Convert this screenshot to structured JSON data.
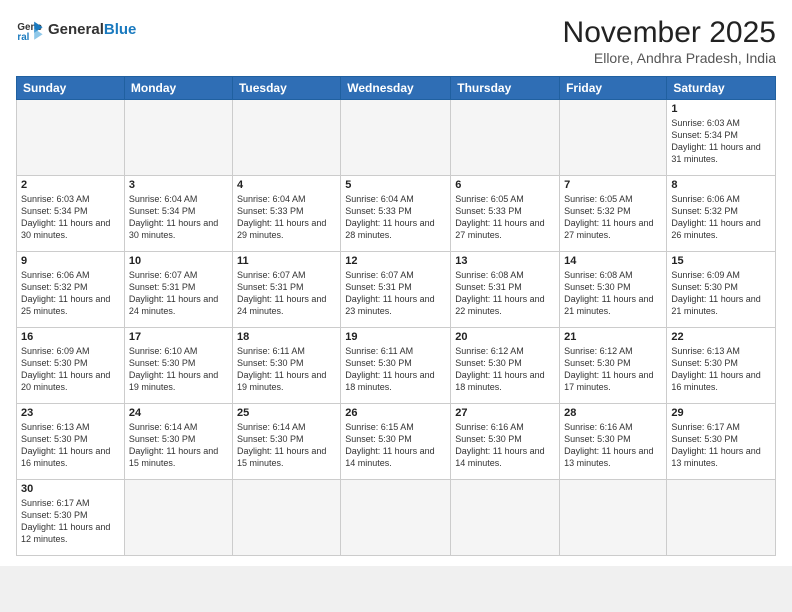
{
  "header": {
    "logo_general": "General",
    "logo_blue": "Blue",
    "month_title": "November 2025",
    "location": "Ellore, Andhra Pradesh, India"
  },
  "weekdays": [
    "Sunday",
    "Monday",
    "Tuesday",
    "Wednesday",
    "Thursday",
    "Friday",
    "Saturday"
  ],
  "weeks": [
    [
      {
        "day": "",
        "empty": true
      },
      {
        "day": "",
        "empty": true
      },
      {
        "day": "",
        "empty": true
      },
      {
        "day": "",
        "empty": true
      },
      {
        "day": "",
        "empty": true
      },
      {
        "day": "",
        "empty": true
      },
      {
        "day": "1",
        "sunrise": "6:03 AM",
        "sunset": "5:34 PM",
        "daylight": "11 hours and 31 minutes."
      }
    ],
    [
      {
        "day": "2",
        "sunrise": "6:03 AM",
        "sunset": "5:34 PM",
        "daylight": "11 hours and 30 minutes."
      },
      {
        "day": "3",
        "sunrise": "6:04 AM",
        "sunset": "5:34 PM",
        "daylight": "11 hours and 30 minutes."
      },
      {
        "day": "4",
        "sunrise": "6:04 AM",
        "sunset": "5:33 PM",
        "daylight": "11 hours and 29 minutes."
      },
      {
        "day": "5",
        "sunrise": "6:04 AM",
        "sunset": "5:33 PM",
        "daylight": "11 hours and 28 minutes."
      },
      {
        "day": "6",
        "sunrise": "6:05 AM",
        "sunset": "5:33 PM",
        "daylight": "11 hours and 27 minutes."
      },
      {
        "day": "7",
        "sunrise": "6:05 AM",
        "sunset": "5:32 PM",
        "daylight": "11 hours and 27 minutes."
      },
      {
        "day": "8",
        "sunrise": "6:06 AM",
        "sunset": "5:32 PM",
        "daylight": "11 hours and 26 minutes."
      }
    ],
    [
      {
        "day": "9",
        "sunrise": "6:06 AM",
        "sunset": "5:32 PM",
        "daylight": "11 hours and 25 minutes."
      },
      {
        "day": "10",
        "sunrise": "6:07 AM",
        "sunset": "5:31 PM",
        "daylight": "11 hours and 24 minutes."
      },
      {
        "day": "11",
        "sunrise": "6:07 AM",
        "sunset": "5:31 PM",
        "daylight": "11 hours and 24 minutes."
      },
      {
        "day": "12",
        "sunrise": "6:07 AM",
        "sunset": "5:31 PM",
        "daylight": "11 hours and 23 minutes."
      },
      {
        "day": "13",
        "sunrise": "6:08 AM",
        "sunset": "5:31 PM",
        "daylight": "11 hours and 22 minutes."
      },
      {
        "day": "14",
        "sunrise": "6:08 AM",
        "sunset": "5:30 PM",
        "daylight": "11 hours and 21 minutes."
      },
      {
        "day": "15",
        "sunrise": "6:09 AM",
        "sunset": "5:30 PM",
        "daylight": "11 hours and 21 minutes."
      }
    ],
    [
      {
        "day": "16",
        "sunrise": "6:09 AM",
        "sunset": "5:30 PM",
        "daylight": "11 hours and 20 minutes."
      },
      {
        "day": "17",
        "sunrise": "6:10 AM",
        "sunset": "5:30 PM",
        "daylight": "11 hours and 19 minutes."
      },
      {
        "day": "18",
        "sunrise": "6:11 AM",
        "sunset": "5:30 PM",
        "daylight": "11 hours and 19 minutes."
      },
      {
        "day": "19",
        "sunrise": "6:11 AM",
        "sunset": "5:30 PM",
        "daylight": "11 hours and 18 minutes."
      },
      {
        "day": "20",
        "sunrise": "6:12 AM",
        "sunset": "5:30 PM",
        "daylight": "11 hours and 18 minutes."
      },
      {
        "day": "21",
        "sunrise": "6:12 AM",
        "sunset": "5:30 PM",
        "daylight": "11 hours and 17 minutes."
      },
      {
        "day": "22",
        "sunrise": "6:13 AM",
        "sunset": "5:30 PM",
        "daylight": "11 hours and 16 minutes."
      }
    ],
    [
      {
        "day": "23",
        "sunrise": "6:13 AM",
        "sunset": "5:30 PM",
        "daylight": "11 hours and 16 minutes."
      },
      {
        "day": "24",
        "sunrise": "6:14 AM",
        "sunset": "5:30 PM",
        "daylight": "11 hours and 15 minutes."
      },
      {
        "day": "25",
        "sunrise": "6:14 AM",
        "sunset": "5:30 PM",
        "daylight": "11 hours and 15 minutes."
      },
      {
        "day": "26",
        "sunrise": "6:15 AM",
        "sunset": "5:30 PM",
        "daylight": "11 hours and 14 minutes."
      },
      {
        "day": "27",
        "sunrise": "6:16 AM",
        "sunset": "5:30 PM",
        "daylight": "11 hours and 14 minutes."
      },
      {
        "day": "28",
        "sunrise": "6:16 AM",
        "sunset": "5:30 PM",
        "daylight": "11 hours and 13 minutes."
      },
      {
        "day": "29",
        "sunrise": "6:17 AM",
        "sunset": "5:30 PM",
        "daylight": "11 hours and 13 minutes."
      }
    ],
    [
      {
        "day": "30",
        "sunrise": "6:17 AM",
        "sunset": "5:30 PM",
        "daylight": "11 hours and 12 minutes."
      },
      {
        "day": "",
        "empty": true
      },
      {
        "day": "",
        "empty": true
      },
      {
        "day": "",
        "empty": true
      },
      {
        "day": "",
        "empty": true
      },
      {
        "day": "",
        "empty": true
      },
      {
        "day": "",
        "empty": true
      }
    ]
  ]
}
